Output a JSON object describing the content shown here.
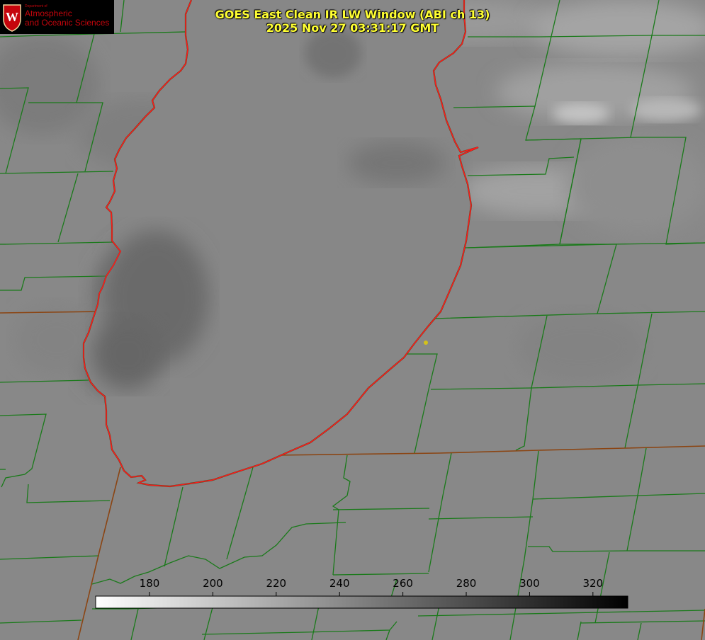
{
  "title": {
    "line1": "GOES East Clean IR LW Window (ABI ch 13)",
    "line2": "2025 Nov 27 03:31:17 GMT"
  },
  "logo": {
    "dept": "Department of",
    "line1": "Atmospheric",
    "line2": "and Oceanic Sciences",
    "crest_letter": "W"
  },
  "colorbar": {
    "ticks": [
      "180",
      "200",
      "220",
      "240",
      "260",
      "280",
      "300",
      "320"
    ],
    "range": [
      163,
      331
    ],
    "gradient": [
      "#ffffff",
      "#000000"
    ]
  },
  "colors": {
    "county_lines": "#1a7a1a",
    "state_lines": "#8b4513",
    "coastline": "#ff1a1a",
    "title_text": "#ffff33",
    "logo_red": "#c5050c",
    "station_marker": "#d4c21a"
  }
}
